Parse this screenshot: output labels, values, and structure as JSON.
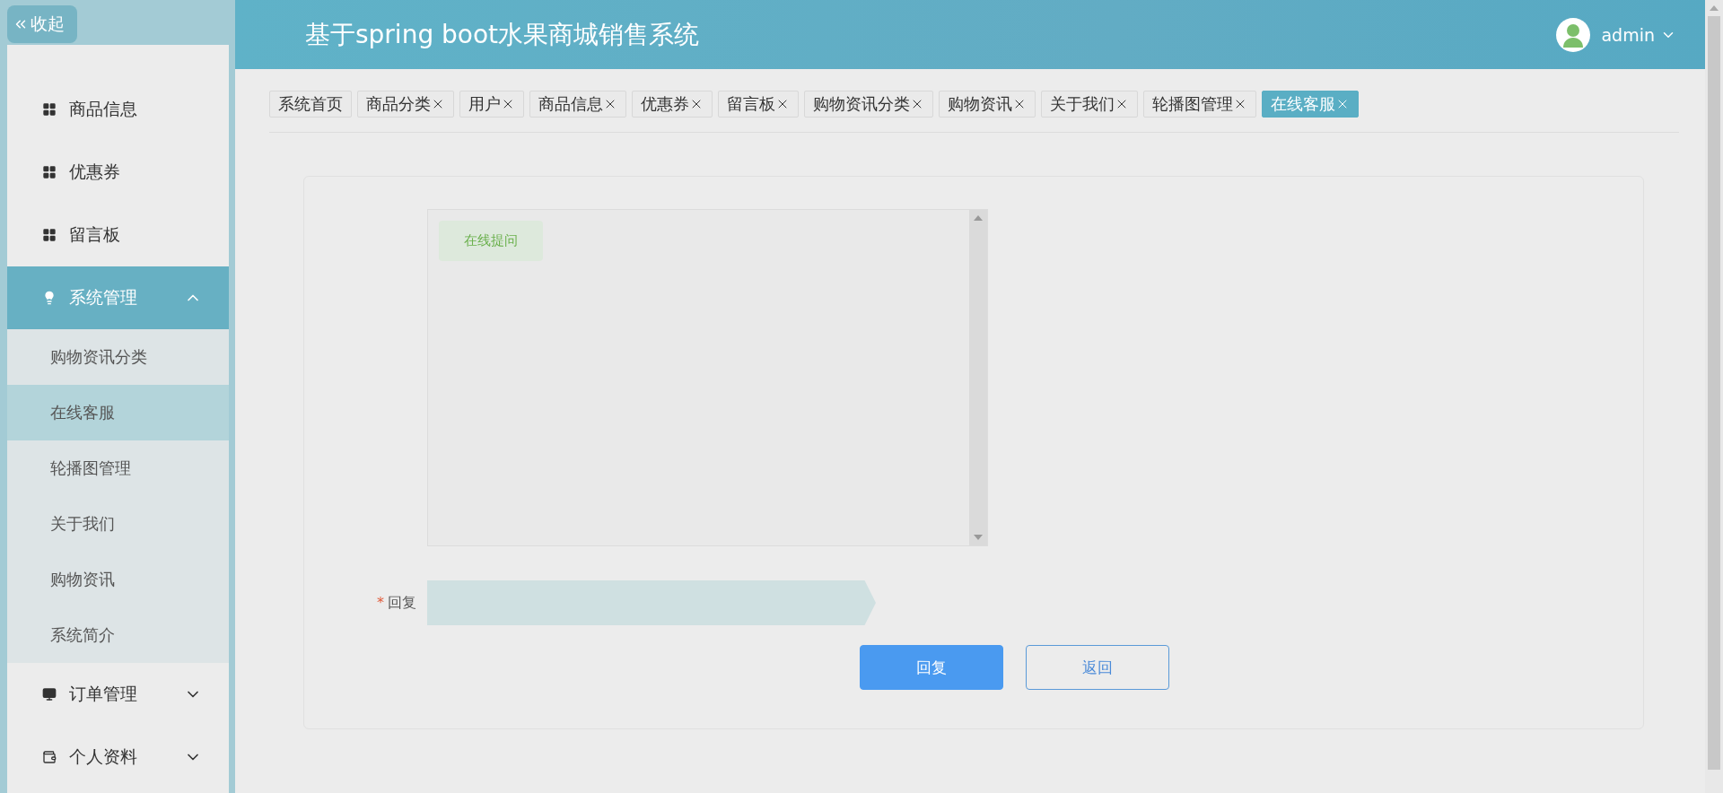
{
  "header": {
    "collapse_button": "收起",
    "title": "基于spring boot水果商城销售系统",
    "user": "admin"
  },
  "sidebar": {
    "items": [
      {
        "label": "商品信息",
        "kind": "link"
      },
      {
        "label": "优惠券",
        "kind": "link"
      },
      {
        "label": "留言板",
        "kind": "link"
      },
      {
        "label": "系统管理",
        "kind": "group",
        "expanded": true,
        "children": [
          {
            "label": "购物资讯分类",
            "selected": false
          },
          {
            "label": "在线客服",
            "selected": true
          },
          {
            "label": "轮播图管理",
            "selected": false
          },
          {
            "label": "关于我们",
            "selected": false
          },
          {
            "label": "购物资讯",
            "selected": false
          },
          {
            "label": "系统简介",
            "selected": false
          }
        ]
      },
      {
        "label": "订单管理",
        "kind": "group",
        "expanded": false
      },
      {
        "label": "个人资料",
        "kind": "group",
        "expanded": false
      }
    ]
  },
  "tabs": [
    {
      "label": "系统首页",
      "closable": false,
      "selected": false
    },
    {
      "label": "商品分类",
      "closable": true,
      "selected": false
    },
    {
      "label": "用户",
      "closable": true,
      "selected": false
    },
    {
      "label": "商品信息",
      "closable": true,
      "selected": false
    },
    {
      "label": "优惠券",
      "closable": true,
      "selected": false
    },
    {
      "label": "留言板",
      "closable": true,
      "selected": false
    },
    {
      "label": "购物资讯分类",
      "closable": true,
      "selected": false
    },
    {
      "label": "购物资讯",
      "closable": true,
      "selected": false
    },
    {
      "label": "关于我们",
      "closable": true,
      "selected": false
    },
    {
      "label": "轮播图管理",
      "closable": true,
      "selected": false
    },
    {
      "label": "在线客服",
      "closable": true,
      "selected": true
    }
  ],
  "chat": {
    "messages": [
      {
        "text": "在线提问"
      }
    ]
  },
  "form": {
    "reply": {
      "label": "回复",
      "required_mark": "*"
    },
    "buttons": [
      {
        "label": "回复",
        "kind": "primary"
      },
      {
        "label": "返回",
        "kind": "secondary"
      }
    ]
  }
}
